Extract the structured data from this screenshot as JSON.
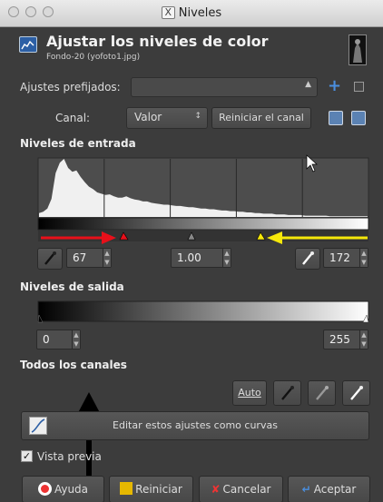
{
  "window": {
    "title": "Niveles"
  },
  "header": {
    "title": "Ajustar los niveles de color",
    "subtitle": "Fondo-20 (yofoto1.jpg)"
  },
  "presets": {
    "label": "Ajustes prefijados:",
    "value": ""
  },
  "channel": {
    "label": "Canal:",
    "value": "Valor",
    "reset_label": "Reiniciar el canal"
  },
  "input_levels": {
    "heading": "Niveles de entrada",
    "low": "67",
    "gamma": "1.00",
    "high": "172",
    "low_fraction": 0.263,
    "high_fraction": 0.674
  },
  "output_levels": {
    "heading": "Niveles de salida",
    "low": "0",
    "high": "255"
  },
  "all_channels": {
    "heading": "Todos los canales",
    "auto_label": "Auto"
  },
  "curves": {
    "label": "Editar estos ajustes como curvas"
  },
  "preview": {
    "label": "Vista previa",
    "checked": true
  },
  "footer": {
    "help": "Ayuda",
    "reset": "Reiniciar",
    "cancel": "Cancelar",
    "ok": "Aceptar"
  },
  "histogram": [
    6,
    8,
    13,
    28,
    68,
    84,
    90,
    76,
    70,
    72,
    62,
    54,
    47,
    43,
    38,
    36,
    34,
    35,
    32,
    30,
    30,
    32,
    29,
    27,
    26,
    24,
    24,
    22,
    21,
    20,
    19,
    19,
    18,
    17,
    17,
    16,
    15,
    15,
    14,
    13,
    13,
    12,
    12,
    11,
    10,
    10,
    9,
    9,
    8,
    8,
    7,
    7,
    6,
    6,
    5,
    5,
    5,
    4,
    4,
    4,
    3,
    3,
    3,
    3,
    2,
    2,
    2,
    2,
    2,
    2,
    1,
    1,
    1,
    1,
    1,
    1,
    1,
    1,
    1,
    1
  ],
  "colors": {
    "annotation_red": "#e8101a",
    "annotation_yellow": "#f6e80a",
    "annotation_black": "#000000",
    "accent_blue": "#4a8fe0"
  }
}
